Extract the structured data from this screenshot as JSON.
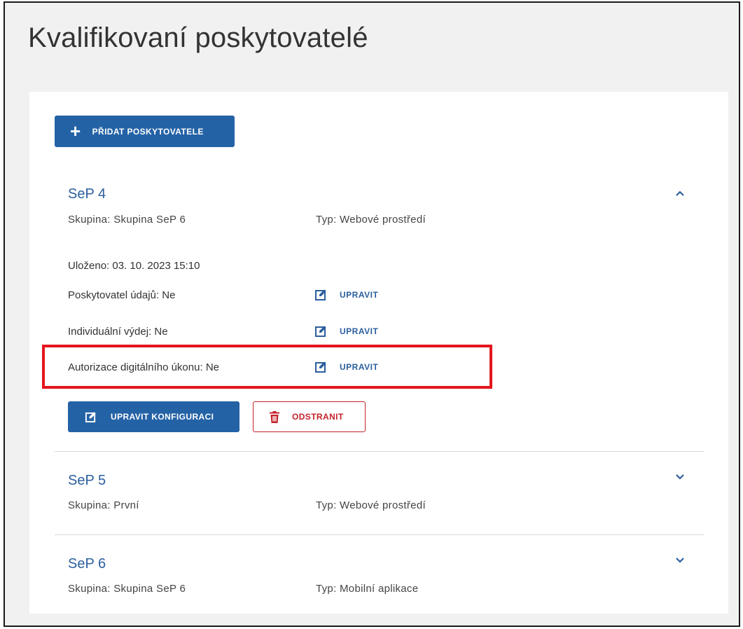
{
  "page": {
    "title": "Kvalifikovaní poskytovatelé"
  },
  "toolbar": {
    "add_label": "PŘIDAT POSKYTOVATELE"
  },
  "colors": {
    "primary": "#2462a6",
    "danger": "#c4222a",
    "highlight": "#e4161e",
    "link": "#2b5f9e"
  },
  "providers": [
    {
      "name": "SeP 4",
      "group_label": "Skupina:",
      "group_value": "Skupina SeP 6",
      "type_label": "Typ:",
      "type_value": "Webové prostředí",
      "expanded": true,
      "saved_label": "Uloženo:",
      "saved_value": "03. 10. 2023 15:10",
      "settings": [
        {
          "label": "Poskytovatel údajů:",
          "value": "Ne",
          "action": "UPRAVIT"
        },
        {
          "label": "Individuální výdej:",
          "value": "Ne",
          "action": "UPRAVIT"
        },
        {
          "label": "Autorizace digitálního úkonu:",
          "value": "Ne",
          "action": "UPRAVIT"
        }
      ],
      "edit_config_label": "UPRAVIT KONFIGURACI",
      "delete_label": "ODSTRANIT"
    },
    {
      "name": "SeP 5",
      "group_label": "Skupina:",
      "group_value": "První",
      "type_label": "Typ:",
      "type_value": "Webové prostředí",
      "expanded": false
    },
    {
      "name": "SeP 6",
      "group_label": "Skupina:",
      "group_value": "Skupina SeP 6",
      "type_label": "Typ:",
      "type_value": "Mobilní aplikace",
      "expanded": false
    }
  ]
}
